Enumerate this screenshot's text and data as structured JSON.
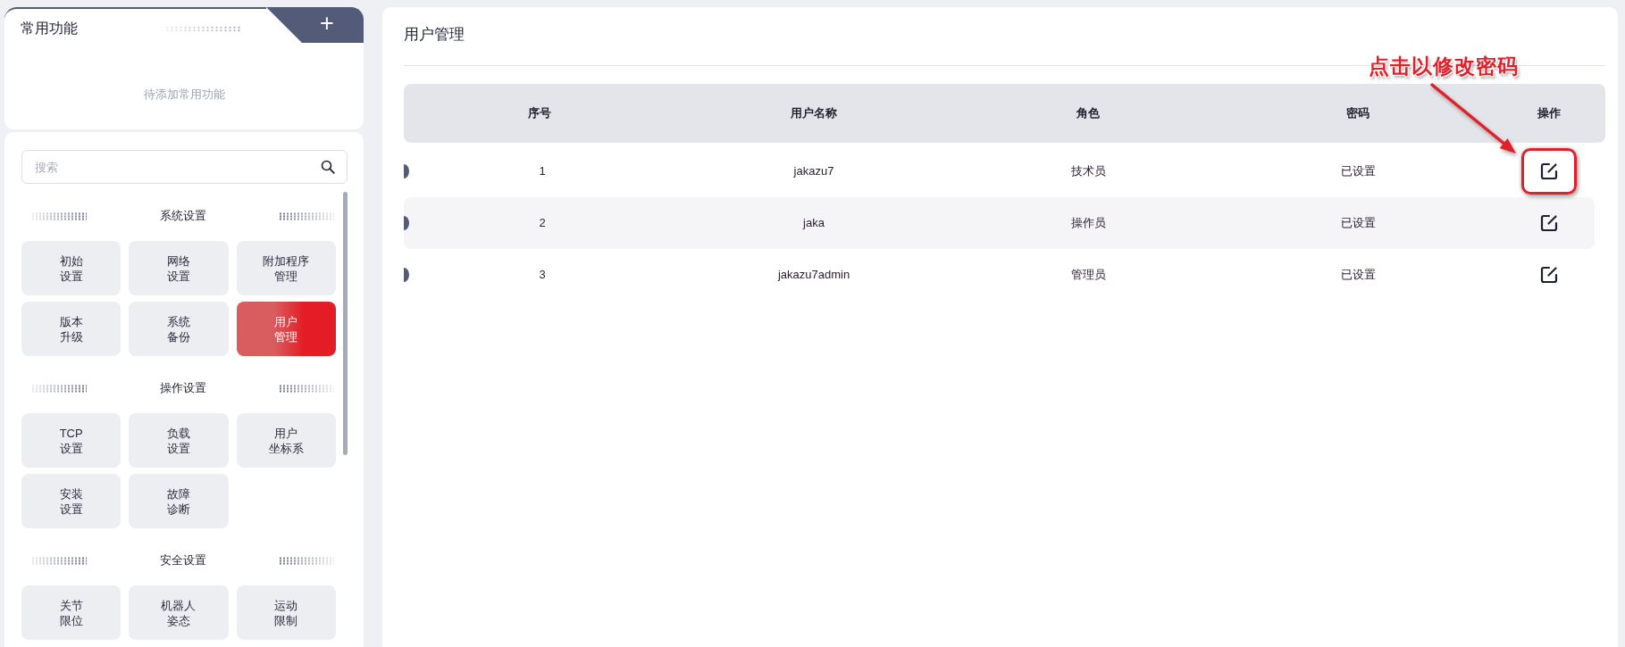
{
  "sidebar": {
    "favorites": {
      "title": "常用功能",
      "add_button": "+",
      "empty_text": "待添加常用功能"
    },
    "search": {
      "placeholder": "搜索"
    },
    "sections": [
      {
        "title": "系统设置",
        "items": [
          {
            "lines": [
              "初始",
              "设置"
            ],
            "selected": false
          },
          {
            "lines": [
              "网络",
              "设置"
            ],
            "selected": false
          },
          {
            "lines": [
              "附加程序",
              "管理"
            ],
            "selected": false
          },
          {
            "lines": [
              "版本",
              "升级"
            ],
            "selected": false
          },
          {
            "lines": [
              "系统",
              "备份"
            ],
            "selected": false
          },
          {
            "lines": [
              "用户",
              "管理"
            ],
            "selected": true
          }
        ]
      },
      {
        "title": "操作设置",
        "items": [
          {
            "lines": [
              "TCP",
              "设置"
            ],
            "selected": false
          },
          {
            "lines": [
              "负载",
              "设置"
            ],
            "selected": false
          },
          {
            "lines": [
              "用户",
              "坐标系"
            ],
            "selected": false
          },
          {
            "lines": [
              "安装",
              "设置"
            ],
            "selected": false
          },
          {
            "lines": [
              "故障",
              "诊断"
            ],
            "selected": false
          }
        ]
      },
      {
        "title": "安全设置",
        "items": [
          {
            "lines": [
              "关节",
              "限位"
            ],
            "selected": false
          },
          {
            "lines": [
              "机器人",
              "姿态"
            ],
            "selected": false
          },
          {
            "lines": [
              "运动",
              "限制"
            ],
            "selected": false
          }
        ]
      }
    ]
  },
  "main": {
    "title": "用户管理",
    "table": {
      "columns": [
        "序号",
        "用户名称",
        "角色",
        "密码",
        "操作"
      ],
      "rows": [
        {
          "cells": [
            "1",
            "jakazu7",
            "技术员",
            "已设置"
          ],
          "annotated": true
        },
        {
          "cells": [
            "2",
            "jaka",
            "操作员",
            "已设置"
          ],
          "annotated": false
        },
        {
          "cells": [
            "3",
            "jakazu7admin",
            "管理员",
            "已设置"
          ],
          "annotated": false
        }
      ]
    }
  },
  "annotation": {
    "text": "点击以修改密码"
  }
}
